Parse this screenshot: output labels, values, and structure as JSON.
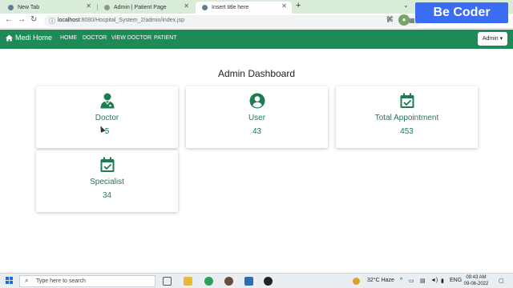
{
  "browser": {
    "tabs": [
      {
        "title": "New Tab"
      },
      {
        "title": "Admin | Patient Page"
      },
      {
        "title": "Insert title here"
      }
    ],
    "address": {
      "host": "localhost",
      "path": ":8080/Hospital_System_2/admin/index.jsp"
    },
    "watermark": "Be Coder"
  },
  "navbar": {
    "brand": "Medi Home",
    "links": [
      "HOME",
      "DOCTOR",
      "VIEW DOCTOR",
      "PATIENT"
    ],
    "admin_label": "Admin"
  },
  "dashboard": {
    "title": "Admin Dashboard",
    "cards": [
      {
        "label": "Doctor",
        "value": "5",
        "icon": "doctor-icon"
      },
      {
        "label": "User",
        "value": "43",
        "icon": "user-circle-icon"
      },
      {
        "label": "Total Appointment",
        "value": "453",
        "icon": "calendar-check-icon"
      },
      {
        "label": "Specialist",
        "value": "34",
        "icon": "calendar-check-icon"
      }
    ],
    "accent_color": "#1e8a57"
  },
  "taskbar": {
    "search_placeholder": "Type here to search",
    "weather": "32°C  Haze",
    "language": "ENG",
    "time": "09:43 AM",
    "date": "09-06-2022"
  }
}
